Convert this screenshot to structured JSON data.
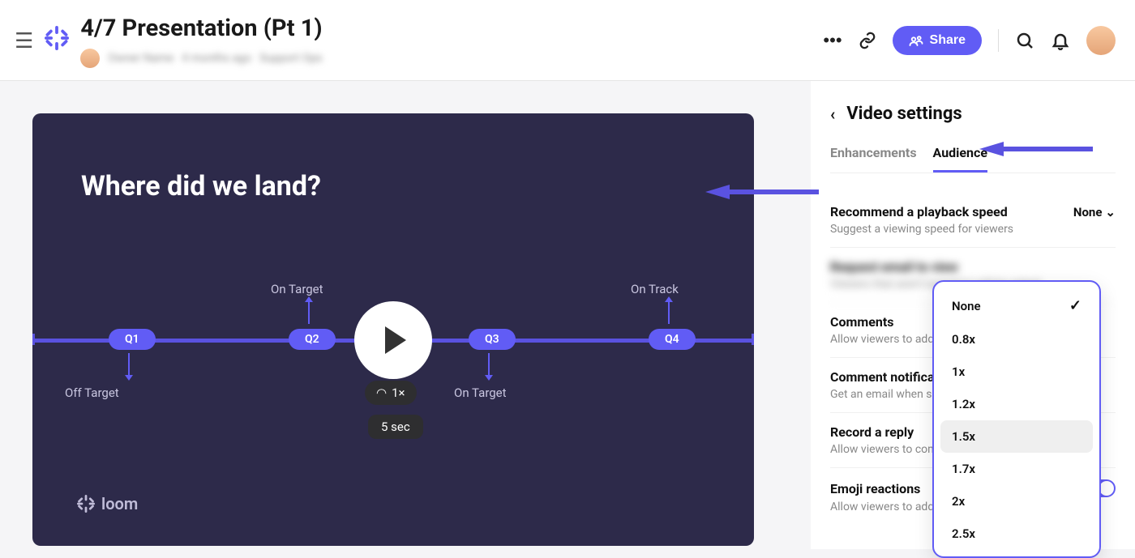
{
  "header": {
    "title": "4/7 Presentation (Pt 1)",
    "meta_author": "Owner Name",
    "meta_time": "4 months ago",
    "meta_folder": "Support Ops",
    "share_label": "Share"
  },
  "video": {
    "slide_title": "Where did we land?",
    "quarters": [
      "Q1",
      "Q2",
      "Q3",
      "Q4"
    ],
    "labels": {
      "q1_below": "Off Target",
      "q2_above": "On Target",
      "q3_below": "On Target",
      "q4_above": "On Track"
    },
    "speed": "1×",
    "duration": "5 sec",
    "brand": "loom"
  },
  "sidebar": {
    "title": "Video settings",
    "tabs": {
      "enhancements": "Enhancements",
      "audience": "Audience"
    },
    "active_tab": "audience",
    "playback": {
      "title": "Recommend a playback speed",
      "hint": "Suggest a viewing speed for viewers",
      "value": "None"
    },
    "blurred1": {
      "title": "Request email to view",
      "hint": "Viewers that aren't logged in will be asked"
    },
    "comments": {
      "title": "Comments",
      "hint": "Allow viewers to add comments"
    },
    "comment_notif": {
      "title": "Comment notifications",
      "hint": "Get an email when someone comments"
    },
    "record_reply": {
      "title": "Record a reply",
      "hint": "Allow viewers to comment with video replies"
    },
    "emoji": {
      "title": "Emoji reactions",
      "hint": "Allow viewers to add reactions"
    },
    "dropdown": {
      "options": [
        "None",
        "0.8x",
        "1x",
        "1.2x",
        "1.5x",
        "1.7x",
        "2x",
        "2.5x"
      ],
      "selected": "None",
      "hovered": "1.5x"
    }
  }
}
